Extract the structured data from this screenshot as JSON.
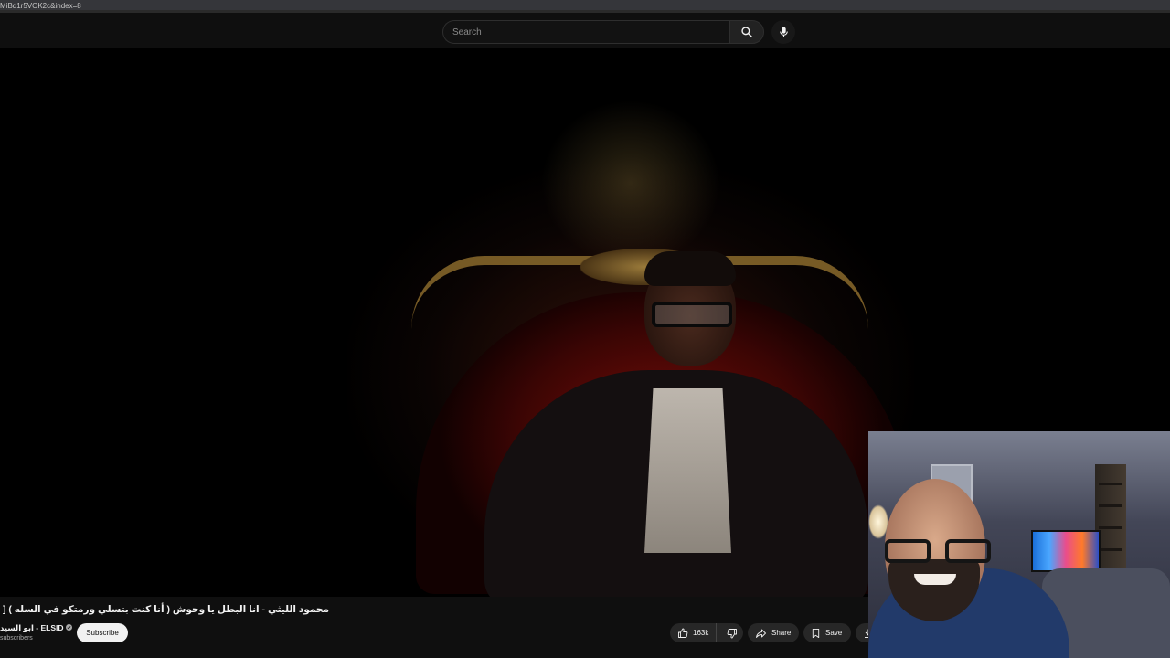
{
  "browser": {
    "url_fragment": "MiBd1r5VOK2c&index=8"
  },
  "header": {
    "search_placeholder": "Search",
    "search_icon": "search-icon",
    "mic_icon": "mic-icon"
  },
  "video": {
    "title": "محمود الليثي - انا البطل يا وحوش ( أنا كنت بتسلي ورمتكو في السله ) [ الفيديو كليب الرسمي",
    "channel_name": "ابو السيد - ELSID",
    "verified_icon": "verified-check-icon",
    "subscribers": "subscribers",
    "subscribe_label": "Subscribe"
  },
  "actions": {
    "like_count": "163k",
    "like_icon": "thumbs-up-icon",
    "dislike_icon": "thumbs-down-icon",
    "share_label": "Share",
    "share_icon": "share-arrow-icon",
    "save_label": "Save",
    "save_icon": "bookmark-icon",
    "download_icon": "download-icon"
  },
  "colors": {
    "background": "#0f0f0f",
    "text": "#f1f1f1",
    "pill": "#272727",
    "subscribe_bg": "#f1f1f1"
  }
}
